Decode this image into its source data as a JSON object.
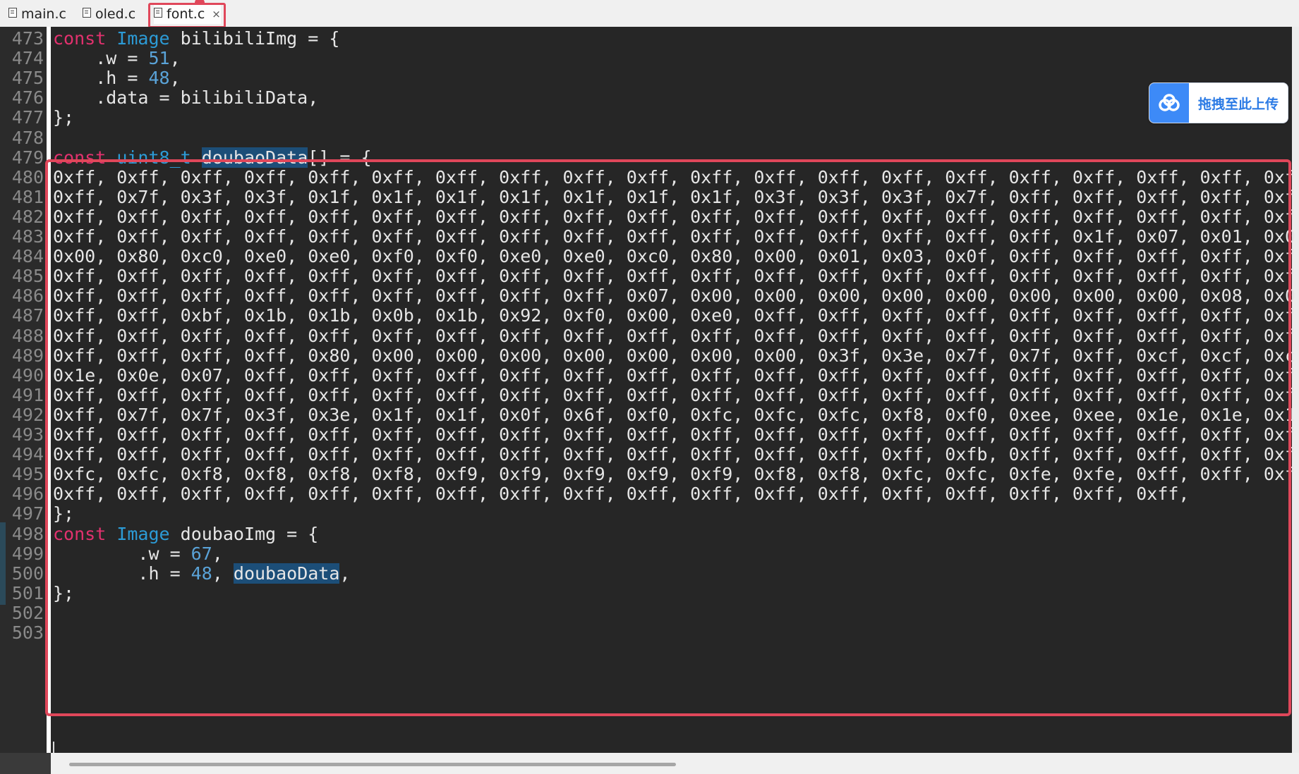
{
  "tabs": [
    {
      "label": "main.c",
      "active": false
    },
    {
      "label": "oled.c",
      "active": false
    },
    {
      "label": "font.c",
      "active": true,
      "close": "×"
    }
  ],
  "upload_widget": {
    "label": "拖拽至此上传",
    "icon": "cloud-upload-icon",
    "color": "#3d8af7"
  },
  "editor": {
    "colors": {
      "keyword": "#e2316e",
      "type": "#2c9bd6",
      "number": "#5aa3d8",
      "highlight_box": "#e0475a"
    },
    "lines": [
      {
        "n": "473",
        "segs": [
          [
            "kw",
            "const"
          ],
          [
            "t",
            " "
          ],
          [
            "ty",
            "Image"
          ],
          [
            "t",
            " bilibiliImg = {"
          ]
        ]
      },
      {
        "n": "474",
        "segs": [
          [
            "t",
            "    .w = "
          ],
          [
            "num",
            "51"
          ],
          [
            "t",
            ","
          ]
        ]
      },
      {
        "n": "475",
        "segs": [
          [
            "t",
            "    .h = "
          ],
          [
            "num",
            "48"
          ],
          [
            "t",
            ","
          ]
        ]
      },
      {
        "n": "476",
        "segs": [
          [
            "t",
            "    .data = bilibiliData,"
          ]
        ]
      },
      {
        "n": "477",
        "segs": [
          [
            "t",
            "};"
          ]
        ]
      },
      {
        "n": "478",
        "segs": []
      },
      {
        "n": "479",
        "segs": [
          [
            "kw",
            "const"
          ],
          [
            "t",
            " "
          ],
          [
            "ty",
            "uint8_t"
          ],
          [
            "t",
            " "
          ],
          [
            "sel",
            "doubaoData"
          ],
          [
            "t",
            "[] = {"
          ]
        ]
      },
      {
        "n": "480",
        "segs": [
          [
            "t",
            "0xff, 0xff, 0xff, 0xff, 0xff, 0xff, 0xff, 0xff, 0xff, 0xff, 0xff, 0xff, 0xff, 0xff, 0xff, 0xff, 0xff, 0xff, 0xff, 0xf"
          ]
        ]
      },
      {
        "n": "481",
        "segs": [
          [
            "t",
            "0xff, 0x7f, 0x3f, 0x3f, 0x1f, 0x1f, 0x1f, 0x1f, 0x1f, 0x1f, 0x1f, 0x3f, 0x3f, 0x3f, 0x7f, 0xff, 0xff, 0xff, 0xff, 0xf"
          ]
        ]
      },
      {
        "n": "482",
        "segs": [
          [
            "t",
            "0xff, 0xff, 0xff, 0xff, 0xff, 0xff, 0xff, 0xff, 0xff, 0xff, 0xff, 0xff, 0xff, 0xff, 0xff, 0xff, 0xff, 0xff, 0xff, 0xf"
          ]
        ]
      },
      {
        "n": "483",
        "segs": [
          [
            "t",
            "0xff, 0xff, 0xff, 0xff, 0xff, 0xff, 0xff, 0xff, 0xff, 0xff, 0xff, 0xff, 0xff, 0xff, 0xff, 0xff, 0x1f, 0x07, 0x01, 0x0"
          ]
        ]
      },
      {
        "n": "484",
        "segs": [
          [
            "t",
            "0x00, 0x80, 0xc0, 0xe0, 0xe0, 0xf0, 0xf0, 0xe0, 0xe0, 0xc0, 0x80, 0x00, 0x01, 0x03, 0x0f, 0xff, 0xff, 0xff, 0xff, 0xf"
          ]
        ]
      },
      {
        "n": "485",
        "segs": [
          [
            "t",
            "0xff, 0xff, 0xff, 0xff, 0xff, 0xff, 0xff, 0xff, 0xff, 0xff, 0xff, 0xff, 0xff, 0xff, 0xff, 0xff, 0xff, 0xff, 0xff, 0xf"
          ]
        ]
      },
      {
        "n": "486",
        "segs": [
          [
            "t",
            "0xff, 0xff, 0xff, 0xff, 0xff, 0xff, 0xff, 0xff, 0xff, 0x07, 0x00, 0x00, 0x00, 0x00, 0x00, 0x00, 0x00, 0x00, 0x08, 0x0"
          ]
        ]
      },
      {
        "n": "487",
        "segs": [
          [
            "t",
            "0xff, 0xff, 0xbf, 0x1b, 0x1b, 0x0b, 0x1b, 0x92, 0xf0, 0x00, 0xe0, 0xff, 0xff, 0xff, 0xff, 0xff, 0xff, 0xff, 0xff, 0xf"
          ]
        ]
      },
      {
        "n": "488",
        "segs": [
          [
            "t",
            "0xff, 0xff, 0xff, 0xff, 0xff, 0xff, 0xff, 0xff, 0xff, 0xff, 0xff, 0xff, 0xff, 0xff, 0xff, 0xff, 0xff, 0xff, 0xff, 0xf"
          ]
        ]
      },
      {
        "n": "489",
        "segs": [
          [
            "t",
            "0xff, 0xff, 0xff, 0xff, 0x80, 0x00, 0x00, 0x00, 0x00, 0x00, 0x00, 0x00, 0x3f, 0x3e, 0x7f, 0x7f, 0xff, 0xcf, 0xcf, 0xc"
          ]
        ]
      },
      {
        "n": "490",
        "segs": [
          [
            "t",
            "0x1e, 0x0e, 0x07, 0xff, 0xff, 0xff, 0xff, 0xff, 0xff, 0xff, 0xff, 0xff, 0xff, 0xff, 0xff, 0xff, 0xff, 0xff, 0xff, 0xf"
          ]
        ]
      },
      {
        "n": "491",
        "segs": [
          [
            "t",
            "0xff, 0xff, 0xff, 0xff, 0xff, 0xff, 0xff, 0xff, 0xff, 0xff, 0xff, 0xff, 0xff, 0xff, 0xff, 0xff, 0xff, 0xff, 0xff, 0xf"
          ]
        ]
      },
      {
        "n": "492",
        "segs": [
          [
            "t",
            "0xff, 0x7f, 0x7f, 0x3f, 0x3e, 0x1f, 0x1f, 0x0f, 0x6f, 0xf0, 0xfc, 0xfc, 0xfc, 0xf8, 0xf0, 0xee, 0xee, 0x1e, 0x1e, 0x1"
          ]
        ]
      },
      {
        "n": "493",
        "segs": [
          [
            "t",
            "0xff, 0xff, 0xff, 0xff, 0xff, 0xff, 0xff, 0xff, 0xff, 0xff, 0xff, 0xff, 0xff, 0xff, 0xff, 0xff, 0xff, 0xff, 0xff, 0xf"
          ]
        ]
      },
      {
        "n": "494",
        "segs": [
          [
            "t",
            "0xff, 0xff, 0xff, 0xff, 0xff, 0xff, 0xff, 0xff, 0xff, 0xff, 0xff, 0xff, 0xff, 0xff, 0xfb, 0xff, 0xff, 0xff, 0xff, 0xf"
          ]
        ]
      },
      {
        "n": "495",
        "segs": [
          [
            "t",
            "0xfc, 0xfc, 0xf8, 0xf8, 0xf8, 0xf8, 0xf9, 0xf9, 0xf9, 0xf9, 0xf9, 0xf8, 0xf8, 0xfc, 0xfc, 0xfe, 0xfe, 0xff, 0xff, 0xf"
          ]
        ]
      },
      {
        "n": "496",
        "segs": [
          [
            "t",
            "0xff, 0xff, 0xff, 0xff, 0xff, 0xff, 0xff, 0xff, 0xff, 0xff, 0xff, 0xff, 0xff, 0xff, 0xff, 0xff, 0xff, 0xff,"
          ]
        ]
      },
      {
        "n": "497",
        "segs": [
          [
            "t",
            "};"
          ]
        ]
      },
      {
        "n": "498",
        "segs": [
          [
            "kw",
            "const"
          ],
          [
            "t",
            " "
          ],
          [
            "ty",
            "Image"
          ],
          [
            "t",
            " doubaoImg = {"
          ]
        ],
        "mark": true
      },
      {
        "n": "499",
        "segs": [
          [
            "t",
            "        .w = "
          ],
          [
            "num",
            "67"
          ],
          [
            "t",
            ","
          ]
        ],
        "mark": true
      },
      {
        "n": "500",
        "segs": [
          [
            "t",
            "        .h = "
          ],
          [
            "num",
            "48"
          ],
          [
            "t",
            ", "
          ],
          [
            "sel",
            "doubaoData"
          ],
          [
            "t",
            ","
          ]
        ],
        "mark": true
      },
      {
        "n": "501",
        "segs": [
          [
            "t",
            "};"
          ]
        ],
        "mark": true
      },
      {
        "n": "502",
        "segs": []
      },
      {
        "n": "503",
        "segs": []
      }
    ]
  }
}
